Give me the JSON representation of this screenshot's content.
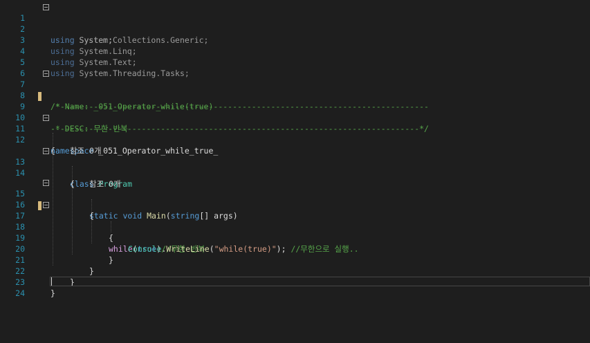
{
  "line_numbers": [
    "1",
    "2",
    "3",
    "4",
    "5",
    "6",
    "7",
    "8",
    "9",
    "10",
    "11",
    "12",
    "13",
    "14",
    "15",
    "16",
    "17",
    "18",
    "19",
    "20",
    "21",
    "22",
    "23",
    "24"
  ],
  "code": {
    "l1_kw": "using",
    "l1_rest": " System;",
    "l2_kw": "using",
    "l2_rest": " System.Collections.Generic;",
    "l3_kw": "using",
    "l3_rest": " System.Linq;",
    "l4_kw": "using",
    "l4_rest": " System.Text;",
    "l5_kw": "using",
    "l5_rest": " System.Threading.Tasks;",
    "l7": "/*-----------------------------------------------------------------------------",
    "l8": " * Name: _051_Operator_while(true)",
    "l9": " * DESC: 무한 반복",
    "l10": "-----------------------------------------------------------------------------*/",
    "l11_kw": "namespace",
    "l11_rest": " _051_Operator_while_true_",
    "l12": "{",
    "ref1": "참조 0개",
    "l13_kw": "class",
    "l13_type": "Program",
    "l14": "{",
    "ref2": "참조 0개",
    "l15_static": "static",
    "l15_void": "void",
    "l15_main": "Main",
    "l15_open": "(",
    "l15_string": "string",
    "l15_args": "[] args)",
    "l16": "{",
    "l17_while": "while",
    "l17_paren_open": "(",
    "l17_true": "true",
    "l17_paren_close": ")",
    "l17_comment": "//무한 반복",
    "l18": "{",
    "l19_console": "Console",
    "l19_dot": ".",
    "l19_writeline": "WriteLine",
    "l19_open": "(",
    "l19_string": "\"while(true)\"",
    "l19_close": "); ",
    "l19_comment": "//무한으로 실행..",
    "l20": "}",
    "l21": "}",
    "l22": "}",
    "l23": "}"
  },
  "colors": {
    "background": "#1e1e1e",
    "line_number": "#2b91af",
    "keyword": "#569cd6",
    "type": "#4ec9b0",
    "method": "#dcdcaa",
    "string": "#d69d85",
    "comment": "#57a64a",
    "control": "#d8a0df",
    "change_marker": "#d7ba7d"
  }
}
